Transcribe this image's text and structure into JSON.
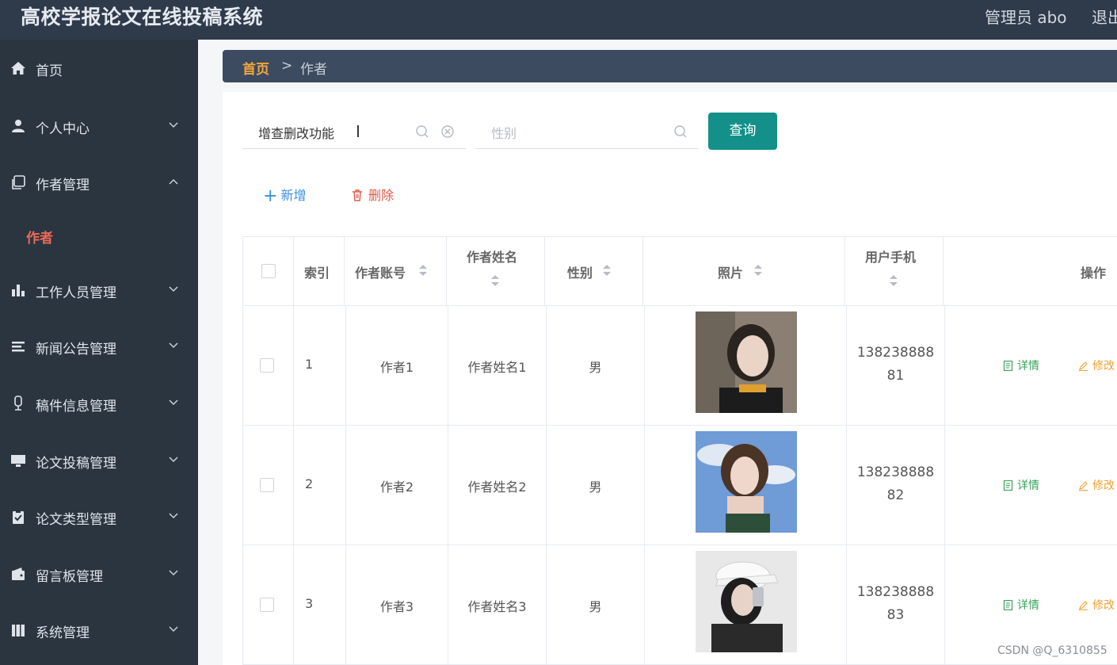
{
  "header": {
    "title": "高校学报论文在线投稿系统",
    "admin": "管理员 abo",
    "logout": "退出"
  },
  "sidebar": {
    "items": [
      {
        "label": "首页",
        "icon": "home-icon"
      },
      {
        "label": "个人中心",
        "icon": "user-icon"
      },
      {
        "label": "作者管理",
        "icon": "copy-icon"
      },
      {
        "label": "工作人员管理",
        "icon": "bar-chart-icon"
      },
      {
        "label": "新闻公告管理",
        "icon": "list-icon"
      },
      {
        "label": "稿件信息管理",
        "icon": "microphone-icon"
      },
      {
        "label": "论文投稿管理",
        "icon": "monitor-icon"
      },
      {
        "label": "论文类型管理",
        "icon": "clipboard-check-icon"
      },
      {
        "label": "留言板管理",
        "icon": "wallet-icon"
      },
      {
        "label": "系统管理",
        "icon": "book-icon"
      }
    ],
    "active_sub": "作者"
  },
  "breadcrumb": {
    "home": "首页",
    "separator": ">",
    "current": "作者"
  },
  "search": {
    "keyword_value": "增查删改功能",
    "gender_placeholder": "性别",
    "query_label": "查询"
  },
  "actions": {
    "add_label": "新增",
    "delete_label": "删除"
  },
  "table": {
    "headers": {
      "index": "索引",
      "account": "作者账号",
      "name": "作者姓名",
      "gender": "性别",
      "photo": "照片",
      "phone": "用户手机",
      "ops": "操作"
    },
    "rows": [
      {
        "index": "1",
        "account": "作者1",
        "name": "作者姓名1",
        "gender": "男",
        "phone_line1": "138238888",
        "phone_line2": "81",
        "detail": "详情",
        "edit": "修改"
      },
      {
        "index": "2",
        "account": "作者2",
        "name": "作者姓名2",
        "gender": "男",
        "phone_line1": "138238888",
        "phone_line2": "82",
        "detail": "详情",
        "edit": "修改"
      },
      {
        "index": "3",
        "account": "作者3",
        "name": "作者姓名3",
        "gender": "男",
        "phone_line1": "138238888",
        "phone_line2": "83",
        "detail": "详情",
        "edit": "修改"
      }
    ]
  },
  "watermark": "CSDN @Q_6310855",
  "colors": {
    "header_bg": "#2f3b4b",
    "sidebar_bg": "#2b3540",
    "accent_teal": "#14908a",
    "breadcrumb_home": "#f4a73a",
    "active_menu": "#ef6a57",
    "add_blue": "#3a8ee6",
    "delete_red": "#e05a4a",
    "detail_green": "#3aa25b",
    "edit_orange": "#f0a030"
  }
}
